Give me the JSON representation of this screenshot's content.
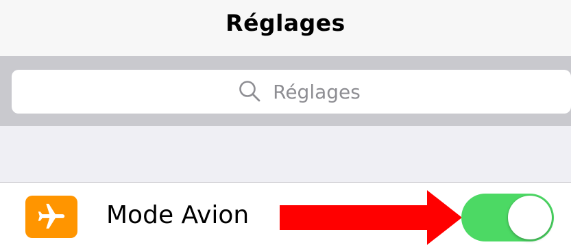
{
  "navbar": {
    "title": "Réglages"
  },
  "search": {
    "placeholder": "Réglages",
    "icon": "search-icon"
  },
  "settings": {
    "airplane_mode": {
      "label": "Mode Avion",
      "icon": "airplane-icon",
      "icon_color": "#ff9500",
      "toggle_on": true,
      "toggle_color": "#4cd964"
    }
  },
  "annotation": {
    "arrow_color": "#ff0000"
  }
}
